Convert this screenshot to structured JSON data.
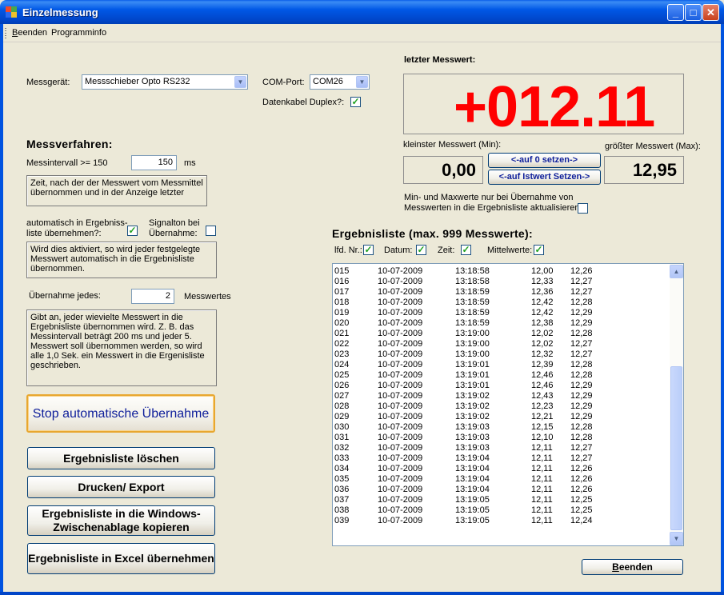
{
  "window": {
    "title": "Einzelmessung",
    "min": "_",
    "max": "□",
    "close": "✕"
  },
  "menu": {
    "beenden_m": "B",
    "beenden_rest": "eenden",
    "programminfo": "Programminfo"
  },
  "device": {
    "messgeraet_label": "Messgerät:",
    "messgeraet_value": "Messschieber Opto RS232",
    "comport_label": "COM-Port:",
    "comport_value": "COM26",
    "duplex_label": "Datenkabel Duplex?:",
    "duplex_checked": "✓"
  },
  "verfahren": {
    "title": "Messverfahren:",
    "intervall_label": "Messintervall >= 150",
    "intervall_value": "150",
    "intervall_unit": "ms",
    "intervall_info": "Zeit, nach der der Messwert vom Messmittel übernommen und in der Anzeige letzter",
    "auto_label_1": "automatisch in Ergebniss-",
    "auto_label_2": "liste übernehmen?:",
    "auto_checked": "✓",
    "signal_label_1": "Signalton bei",
    "signal_label_2": "Übernahme:",
    "auto_info": "Wird dies aktiviert, so wird jeder festgelegte Messwert automatisch in die Ergebnisliste übernommen.",
    "uebernahme_label": "Übernahme jedes:",
    "uebernahme_value": "2",
    "uebernahme_unit": "Messwertes",
    "uebernahme_info": "Gibt an, jeder wievielte Messwert in die Ergebnisliste übernommen wird.  Z. B. das Messintervall beträgt 200 ms und jeder 5. Messwert soll übernommen werden, so wird alle 1,0 Sek. ein Messwert in die Ergenisliste geschrieben."
  },
  "buttons": {
    "stop": "Stop automatische Übernahme",
    "loeschen": "Ergebnisliste löschen",
    "drucken": "Drucken/ Export",
    "clipboard": "Ergebnisliste in die Windows-Zwischenablage kopieren",
    "excel": "Ergebnisliste in Excel übernehmen",
    "beenden_m": "B",
    "beenden_rest": "eenden",
    "auf_null": "<-auf 0 setzen->",
    "auf_ist": "<-auf Istwert Setzen->"
  },
  "display": {
    "title": "letzter Messwert:",
    "value": "+012.11",
    "min_label": "kleinster Messwert (Min):",
    "min_value": "0,00",
    "max_label": "größter Messwert (Max):",
    "max_value": "12,95",
    "minmax_note_1": "Min- und Maxwerte nur bei Übernahme von",
    "minmax_note_2": "Messwerten in die Ergebnisliste aktualisieren:"
  },
  "list": {
    "title": "Ergebnisliste (max. 999 Messwerte):",
    "col_lfd": "lfd. Nr.:",
    "col_datum": "Datum:",
    "col_zeit": "Zeit:",
    "col_mittel": "Mittelwerte:",
    "rows": [
      [
        "015",
        "10-07-2009",
        "13:18:58",
        "12,00",
        "12,26"
      ],
      [
        "016",
        "10-07-2009",
        "13:18:58",
        "12,33",
        "12,27"
      ],
      [
        "017",
        "10-07-2009",
        "13:18:59",
        "12,36",
        "12,27"
      ],
      [
        "018",
        "10-07-2009",
        "13:18:59",
        "12,42",
        "12,28"
      ],
      [
        "019",
        "10-07-2009",
        "13:18:59",
        "12,42",
        "12,29"
      ],
      [
        "020",
        "10-07-2009",
        "13:18:59",
        "12,38",
        "12,29"
      ],
      [
        "021",
        "10-07-2009",
        "13:19:00",
        "12,02",
        "12,28"
      ],
      [
        "022",
        "10-07-2009",
        "13:19:00",
        "12,02",
        "12,27"
      ],
      [
        "023",
        "10-07-2009",
        "13:19:00",
        "12,32",
        "12,27"
      ],
      [
        "024",
        "10-07-2009",
        "13:19:01",
        "12,39",
        "12,28"
      ],
      [
        "025",
        "10-07-2009",
        "13:19:01",
        "12,46",
        "12,28"
      ],
      [
        "026",
        "10-07-2009",
        "13:19:01",
        "12,46",
        "12,29"
      ],
      [
        "027",
        "10-07-2009",
        "13:19:02",
        "12,43",
        "12,29"
      ],
      [
        "028",
        "10-07-2009",
        "13:19:02",
        "12,23",
        "12,29"
      ],
      [
        "029",
        "10-07-2009",
        "13:19:02",
        "12,21",
        "12,29"
      ],
      [
        "030",
        "10-07-2009",
        "13:19:03",
        "12,15",
        "12,28"
      ],
      [
        "031",
        "10-07-2009",
        "13:19:03",
        "12,10",
        "12,28"
      ],
      [
        "032",
        "10-07-2009",
        "13:19:03",
        "12,11",
        "12,27"
      ],
      [
        "033",
        "10-07-2009",
        "13:19:04",
        "12,11",
        "12,27"
      ],
      [
        "034",
        "10-07-2009",
        "13:19:04",
        "12,11",
        "12,26"
      ],
      [
        "035",
        "10-07-2009",
        "13:19:04",
        "12,11",
        "12,26"
      ],
      [
        "036",
        "10-07-2009",
        "13:19:04",
        "12,11",
        "12,26"
      ],
      [
        "037",
        "10-07-2009",
        "13:19:05",
        "12,11",
        "12,25"
      ],
      [
        "038",
        "10-07-2009",
        "13:19:05",
        "12,11",
        "12,25"
      ],
      [
        "039",
        "10-07-2009",
        "13:19:05",
        "12,11",
        "12,24"
      ]
    ]
  },
  "colors": {
    "display_red": "#ff0000",
    "title_blue": "#0058e6",
    "accent_button_text": "#0e1e9a"
  }
}
